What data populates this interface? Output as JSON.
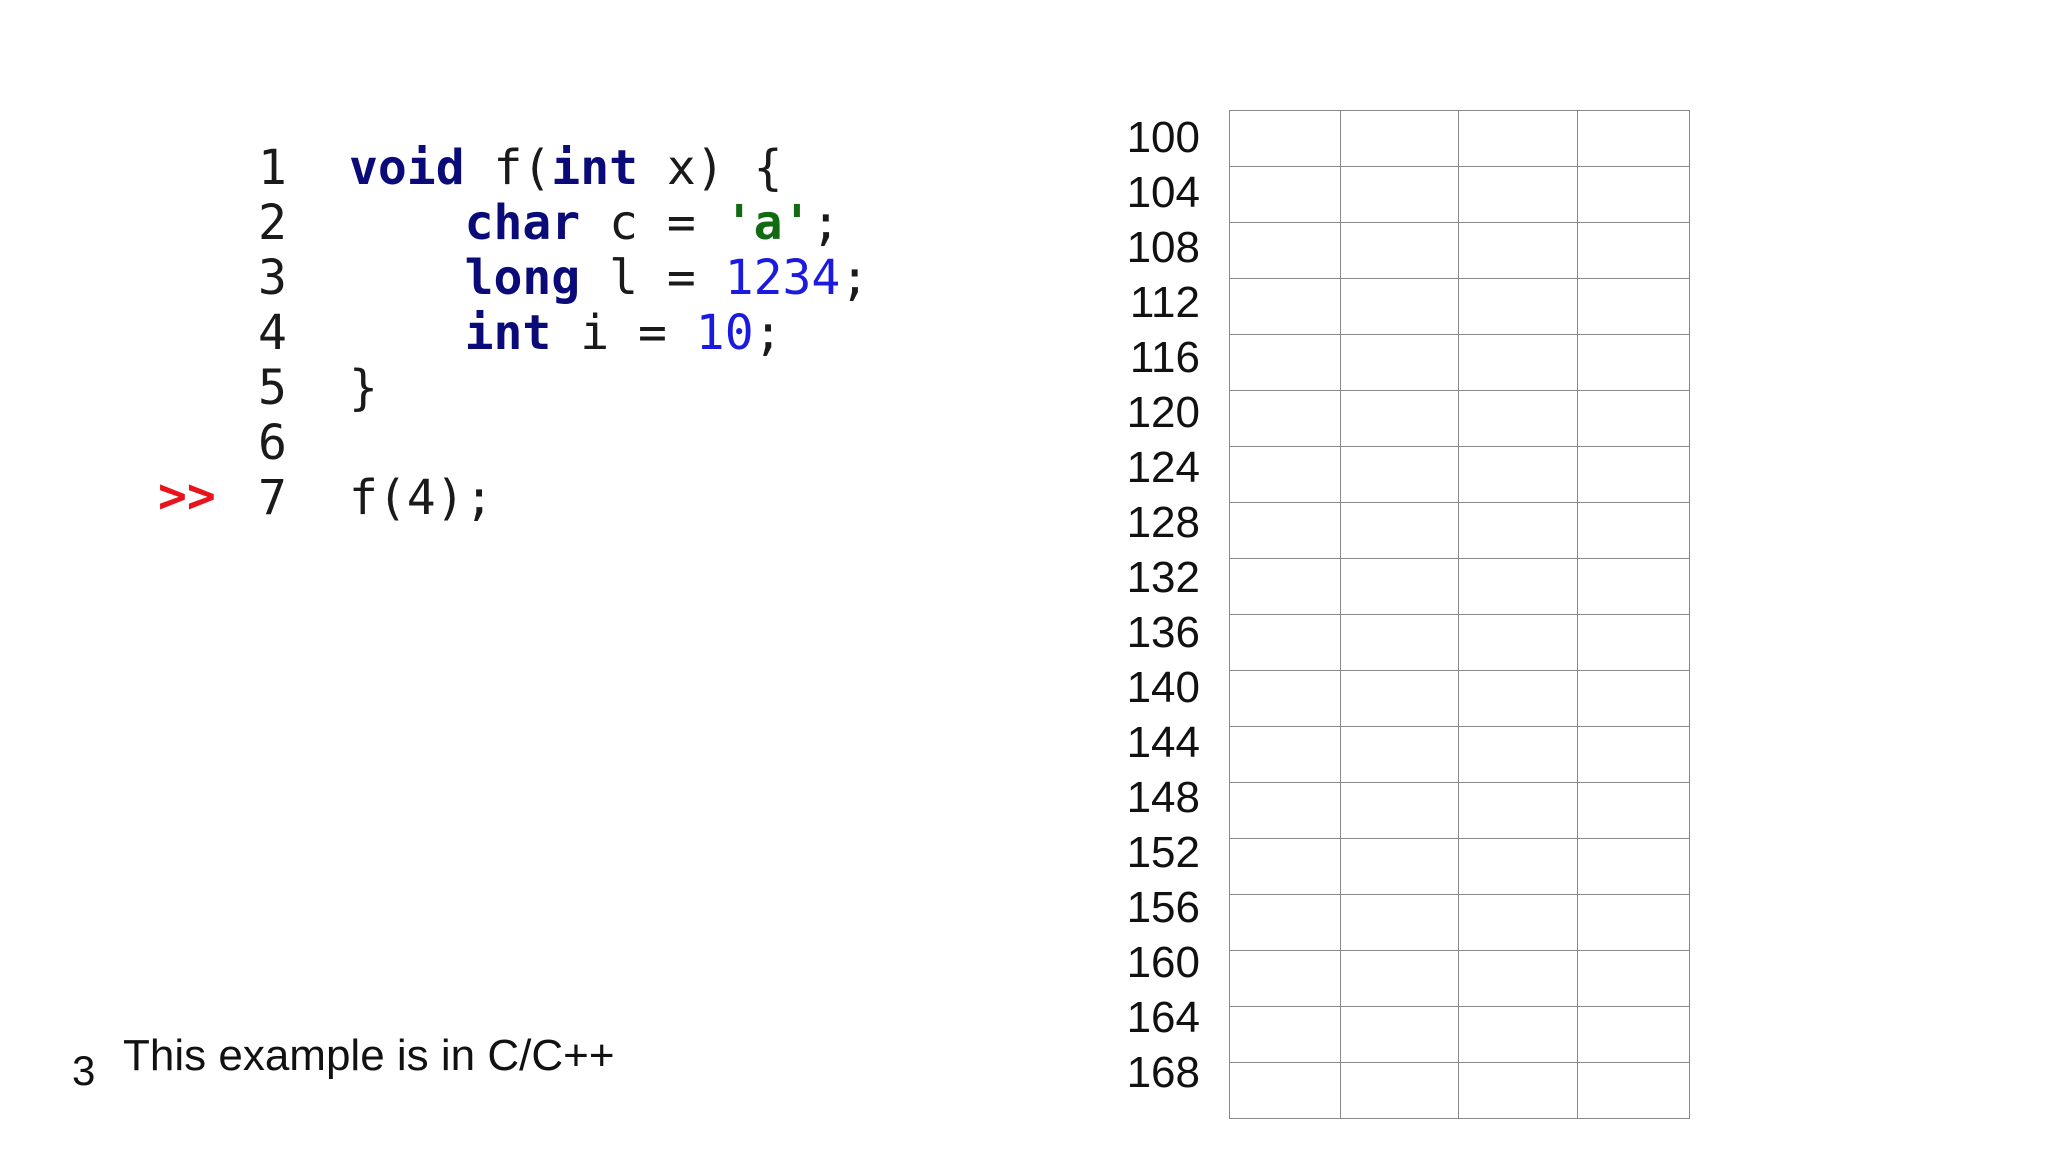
{
  "code": {
    "current_marker": ">>",
    "lines": [
      {
        "num": "1",
        "parts": [
          {
            "t": "void",
            "c": "kw"
          },
          {
            "t": " f(",
            "c": ""
          },
          {
            "t": "int",
            "c": "kw"
          },
          {
            "t": " x) {",
            "c": ""
          }
        ]
      },
      {
        "num": "2",
        "parts": [
          {
            "t": "    ",
            "c": ""
          },
          {
            "t": "char",
            "c": "kw"
          },
          {
            "t": " c = ",
            "c": ""
          },
          {
            "t": "'a'",
            "c": "str"
          },
          {
            "t": ";",
            "c": ""
          }
        ]
      },
      {
        "num": "3",
        "parts": [
          {
            "t": "    ",
            "c": ""
          },
          {
            "t": "long",
            "c": "kw"
          },
          {
            "t": " l = ",
            "c": ""
          },
          {
            "t": "1234",
            "c": "num"
          },
          {
            "t": ";",
            "c": ""
          }
        ]
      },
      {
        "num": "4",
        "parts": [
          {
            "t": "    ",
            "c": ""
          },
          {
            "t": "int",
            "c": "kw"
          },
          {
            "t": " i = ",
            "c": ""
          },
          {
            "t": "10",
            "c": "num"
          },
          {
            "t": ";",
            "c": ""
          }
        ]
      },
      {
        "num": "5",
        "parts": [
          {
            "t": "}",
            "c": ""
          }
        ]
      },
      {
        "num": "6",
        "parts": []
      },
      {
        "num": "7",
        "parts": [
          {
            "t": "f(4);",
            "c": ""
          }
        ]
      }
    ]
  },
  "memory": {
    "addresses": [
      "100",
      "104",
      "108",
      "112",
      "116",
      "120",
      "124",
      "128",
      "132",
      "136",
      "140",
      "144",
      "148",
      "152",
      "156",
      "160",
      "164",
      "168"
    ],
    "columns": 4
  },
  "footer": {
    "slide_number": "3",
    "note": "This example is in C/C++"
  },
  "colors": {
    "keyword": "#0a0a78",
    "string": "#126b12",
    "number": "#1a1ae0",
    "marker": "#e8131b",
    "grid": "#888888"
  }
}
